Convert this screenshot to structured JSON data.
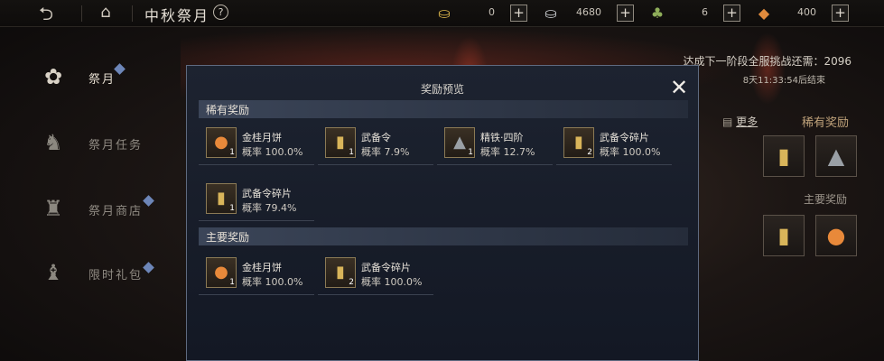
{
  "topbar": {
    "title": "中秋祭月",
    "help": "?",
    "currencies": [
      {
        "icon": "gold-ingot-icon",
        "value": "0"
      },
      {
        "icon": "silver-ingot-icon",
        "value": "4680"
      },
      {
        "icon": "stamina-potion-icon",
        "value": "6"
      },
      {
        "icon": "festival-token-icon",
        "value": "400"
      }
    ],
    "plus": "+"
  },
  "nav": [
    {
      "label": "祭月",
      "icon": "fan-icon",
      "active": true
    },
    {
      "label": "祭月任务",
      "icon": "rabbit-icon",
      "active": false
    },
    {
      "label": "祭月商店",
      "icon": "shop-bag-icon",
      "active": false
    },
    {
      "label": "限时礼包",
      "icon": "gift-bag-icon",
      "active": false
    }
  ],
  "right": {
    "stage_requirement": "达成下一阶段全服挑战还需：2096",
    "countdown": "8天11:33:54后结束",
    "more": "更多",
    "rare_heading": "稀有奖励",
    "main_heading": "主要奖励"
  },
  "modal": {
    "title": "奖励预览",
    "close": "✕",
    "sections": [
      {
        "heading": "稀有奖励",
        "items": [
          {
            "name": "金桂月饼",
            "rate": "概率 100.0%",
            "qty": "1",
            "icon": "mooncake-icon"
          },
          {
            "name": "武备令",
            "rate": "概率 7.9%",
            "qty": "1",
            "icon": "token-icon"
          },
          {
            "name": "精铁·四阶",
            "rate": "概率 12.7%",
            "qty": "1",
            "icon": "iron-ingot-icon"
          },
          {
            "name": "武备令碎片",
            "rate": "概率 100.0%",
            "qty": "2",
            "icon": "token-fragment-icon"
          },
          {
            "name": "武备令碎片",
            "rate": "概率 79.4%",
            "qty": "1",
            "icon": "token-fragment-icon"
          }
        ]
      },
      {
        "heading": "主要奖励",
        "items": [
          {
            "name": "金桂月饼",
            "rate": "概率 100.0%",
            "qty": "1",
            "icon": "mooncake-icon"
          },
          {
            "name": "武备令碎片",
            "rate": "概率 100.0%",
            "qty": "2",
            "icon": "token-fragment-icon"
          }
        ]
      }
    ]
  }
}
